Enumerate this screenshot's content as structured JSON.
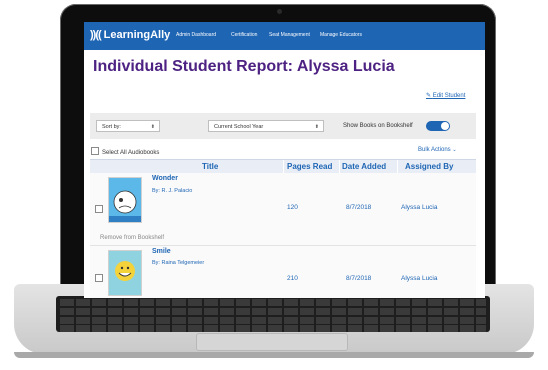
{
  "app": {
    "logo_mark": "))((",
    "logo_text": "LearningAlly"
  },
  "nav": [
    {
      "label": "Admin Dashboard"
    },
    {
      "label": "Certification"
    },
    {
      "label": "Seat Management"
    },
    {
      "label": "Manage Educators"
    }
  ],
  "page": {
    "title": "Individual Student Report: Alyssa Lucia",
    "edit_link": "Edit Student"
  },
  "toolbar": {
    "sort_label": "Sort by:",
    "year_label": "Current School Year",
    "show_books_label": "Show Books on Bookshelf",
    "show_books_on": true
  },
  "list": {
    "select_all_label": "Select All Audiobooks",
    "bulk_actions_label": "Bulk Actions",
    "columns": [
      "Title",
      "Pages Read",
      "Date Added",
      "Assigned By"
    ],
    "rows": [
      {
        "title": "Wonder",
        "author": "By: R. J. Palacio",
        "pages_read": "120",
        "date_added": "8/7/2018",
        "assigned_by": "Alyssa Lucia",
        "remove_label": "Remove from Bookshelf"
      },
      {
        "title": "Smile",
        "author": "By: Raina Telgemeier",
        "pages_read": "210",
        "date_added": "8/7/2018",
        "assigned_by": "Alyssa Lucia"
      }
    ]
  },
  "colors": {
    "brand_blue": "#1e65b4",
    "title_purple": "#4d2283"
  }
}
